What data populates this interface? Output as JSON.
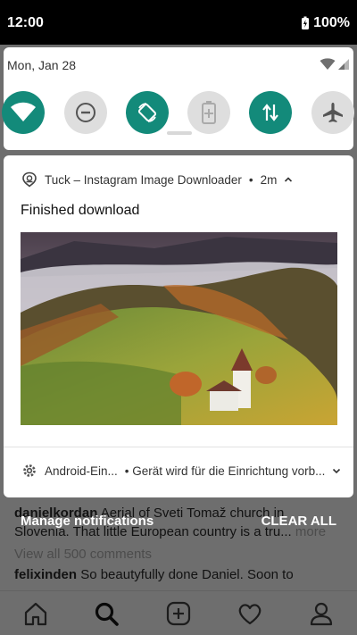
{
  "status_bar": {
    "time": "12:00",
    "battery": "100%"
  },
  "quick_settings": {
    "date": "Mon, Jan 28",
    "tiles": [
      {
        "name": "wifi",
        "state": "on"
      },
      {
        "name": "do-not-disturb",
        "state": "off"
      },
      {
        "name": "auto-rotate",
        "state": "on"
      },
      {
        "name": "battery-saver",
        "state": "off"
      },
      {
        "name": "mobile-data",
        "state": "on"
      },
      {
        "name": "airplane-mode",
        "state": "off"
      }
    ]
  },
  "notification": {
    "app_name": "Tuck – Instagram Image Downloader",
    "time_sep": "•",
    "time": "2m",
    "title": "Finished download"
  },
  "notification2": {
    "app_name": "Android-Ein...",
    "text": "• Gerät wird für die Einrichtung vorb..."
  },
  "actions": {
    "manage": "Manage notifications",
    "clear_all": "CLEAR ALL"
  },
  "background_feed": {
    "line1_user": "danielkordan",
    "line1_text": "Aerial of Sveti Tomaž church in",
    "line2_text": "Slovenia. That little European country is a tru...",
    "line2_more": "more",
    "comments": "View all 500 comments",
    "comment_user": "felixinden",
    "comment_text": "So beautyfully done Daniel. Soon to"
  },
  "colors": {
    "accent": "#138a7a",
    "tile_off": "#dedede",
    "status_bar_bg": "#000000"
  }
}
